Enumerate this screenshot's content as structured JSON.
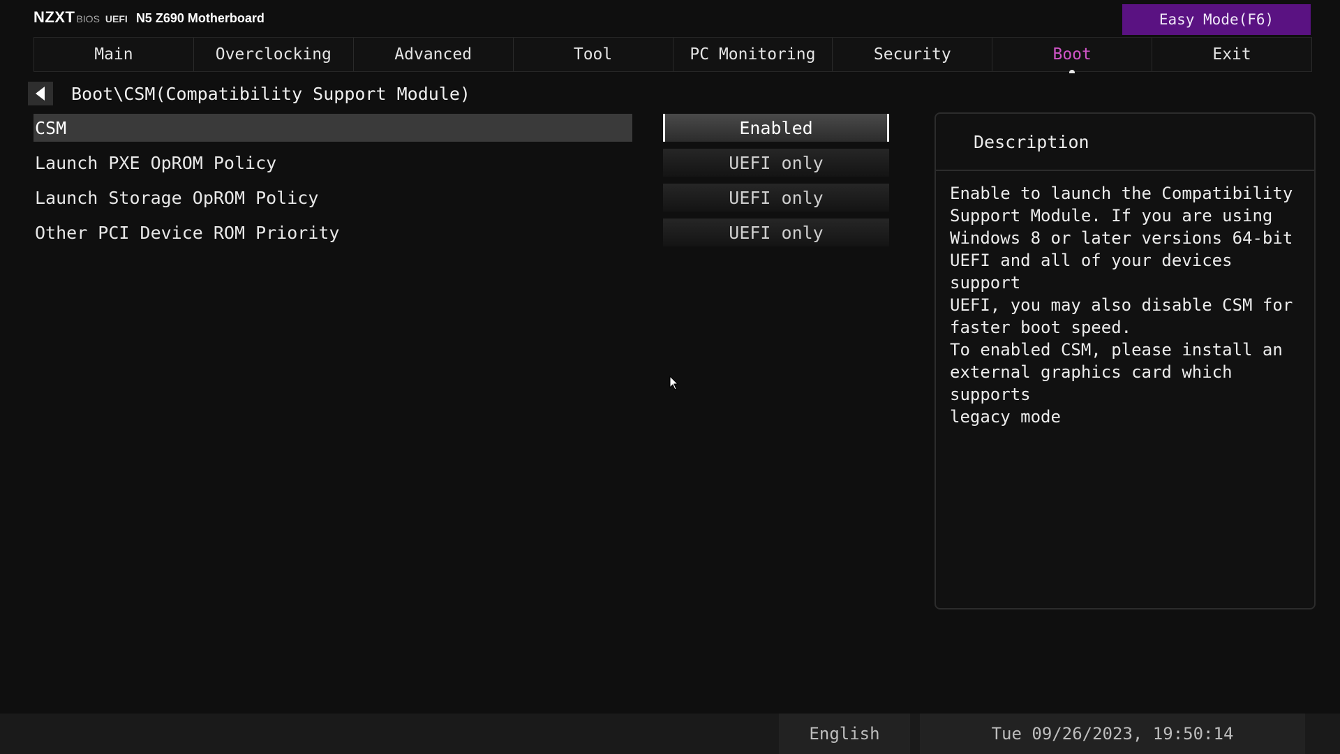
{
  "header": {
    "logo": "NZXT",
    "bios_label": "BIOS",
    "uefi_label": "UEFI",
    "model": "N5 Z690 Motherboard",
    "easy_mode": "Easy Mode(F6)"
  },
  "tabs": [
    {
      "label": "Main"
    },
    {
      "label": "Overclocking"
    },
    {
      "label": "Advanced"
    },
    {
      "label": "Tool"
    },
    {
      "label": "PC Monitoring"
    },
    {
      "label": "Security"
    },
    {
      "label": "Boot"
    },
    {
      "label": "Exit"
    }
  ],
  "active_tab": "Boot",
  "breadcrumb": {
    "back_icon": "triangle-left-icon",
    "path": "Boot\\CSM(Compatibility Support Module)"
  },
  "settings": [
    {
      "label": "CSM",
      "value": "Enabled"
    },
    {
      "label": "Launch PXE OpROM Policy",
      "value": "UEFI only"
    },
    {
      "label": "Launch Storage OpROM Policy",
      "value": "UEFI only"
    },
    {
      "label": "Other PCI Device ROM Priority",
      "value": "UEFI only"
    }
  ],
  "selected_setting": "CSM",
  "description": {
    "title": "Description",
    "text": "Enable to launch the Compatibility\nSupport Module. If you are using\nWindows 8 or later versions 64-bit\nUEFI and all of your devices support\nUEFI, you may also disable CSM for\nfaster boot speed.\nTo enabled CSM, please install an\nexternal graphics card which supports\nlegacy mode"
  },
  "footer": {
    "language": "English",
    "datetime": "Tue 09/26/2023, 19:50:14"
  },
  "colors": {
    "accent": "#d055c8",
    "easy_mode_bg": "#5a1282",
    "background": "#0f0f0f",
    "selected_row": "#3a3a3a"
  }
}
